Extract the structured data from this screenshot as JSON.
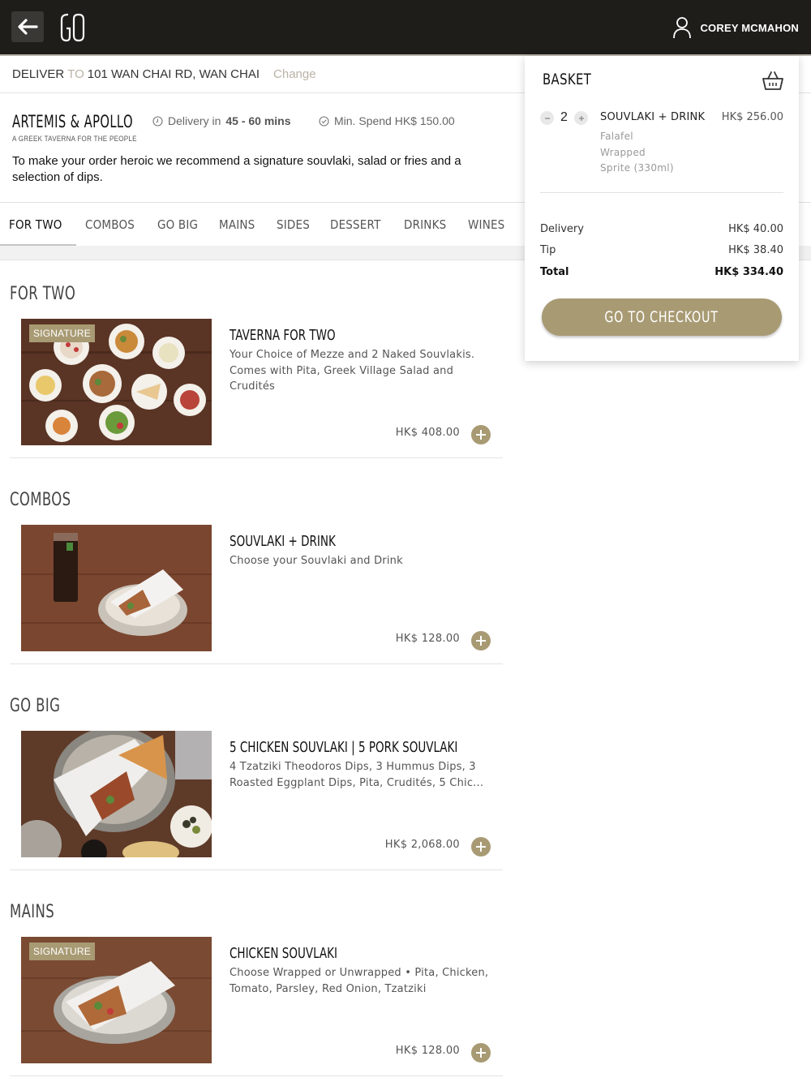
{
  "header": {
    "logo_text": "GO",
    "user_name": "COREY MCMAHON"
  },
  "delivery": {
    "deliver_label": "DELIVER",
    "to_label": "TO",
    "address": "101 WAN CHAI RD, WAN CHAI",
    "change_label": "Change"
  },
  "restaurant": {
    "name": "ARTEMIS & APOLLO",
    "subtitle": "A GREEK TAVERNA FOR THE PEOPLE",
    "delivery_prefix": "Delivery in",
    "delivery_time": "45 - 60 mins",
    "min_spend": "Min. Spend HK$ 150.00",
    "description": "To make your order heroic we recommend a signature souvlaki, salad or fries and a selection of dips."
  },
  "tabs": [
    {
      "label": "FOR TWO"
    },
    {
      "label": "COMBOS"
    },
    {
      "label": "GO BIG"
    },
    {
      "label": "MAINS"
    },
    {
      "label": "SIDES"
    },
    {
      "label": "DESSERT"
    },
    {
      "label": "DRINKS"
    },
    {
      "label": "WINES"
    }
  ],
  "sections": [
    {
      "title": "FOR TWO",
      "item": {
        "badge": "SIGNATURE",
        "name": "TAVERNA FOR TWO",
        "description": "Your Choice of Mezze and 2 Naked Souvlakis. Comes with Pita, Greek Village Salad and Crudités",
        "price": "HK$ 408.00"
      }
    },
    {
      "title": "COMBOS",
      "item": {
        "badge": "",
        "name": "SOUVLAKI + DRINK",
        "description": "Choose your Souvlaki and Drink",
        "price": "HK$ 128.00"
      }
    },
    {
      "title": "GO BIG",
      "item": {
        "badge": "",
        "name": "5 CHICKEN SOUVLAKI | 5 PORK SOUVLAKI",
        "description": "4 Tzatziki Theodoros Dips, 3 Hummus Dips, 3 Roasted Eggplant Dips, Pita, Crudités, 5 Chic...",
        "price": "HK$ 2,068.00"
      }
    },
    {
      "title": "MAINS",
      "item": {
        "badge": "SIGNATURE",
        "name": "CHICKEN SOUVLAKI",
        "description": "Choose Wrapped or Unwrapped • Pita, Chicken, Tomato, Parsley, Red Onion, Tzatziki",
        "price": "HK$ 128.00"
      }
    }
  ],
  "basket": {
    "title": "BASKET",
    "line": {
      "quantity": "2",
      "name": "SOUVLAKI + DRINK",
      "price": "HK$ 256.00",
      "options": [
        "Falafel",
        "Wrapped",
        "Sprite (330ml)"
      ]
    },
    "delivery_label": "Delivery",
    "delivery_value": "HK$ 40.00",
    "tip_label": "Tip",
    "tip_value": "HK$ 38.40",
    "total_label": "Total",
    "total_value": "HK$ 334.40",
    "checkout_label": "GO TO CHECKOUT"
  },
  "colors": {
    "accent": "#a89a73",
    "topbar": "#1f1d1a"
  },
  "icons": [
    "back-arrow-icon",
    "user-icon",
    "clock-icon",
    "check-circle-icon",
    "basket-icon",
    "plus-icon",
    "minus-icon"
  ]
}
